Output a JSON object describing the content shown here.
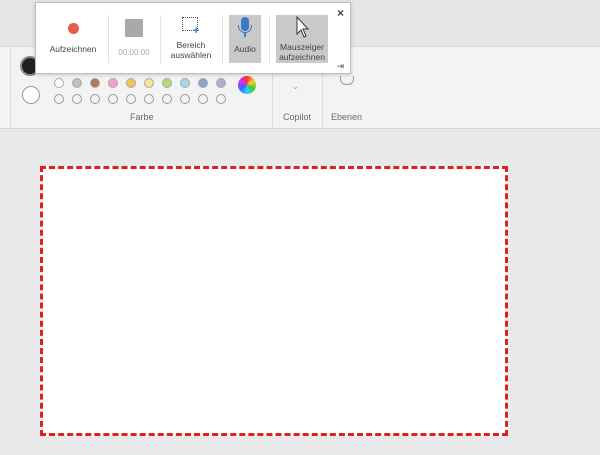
{
  "ribbon": {
    "groups": {
      "farbe": "Farbe",
      "copilot": "Copilot",
      "ebenen": "Ebenen"
    },
    "colors": {
      "row1": [
        "#ffffff",
        "#c0c0c0",
        "#b07a55",
        "#f2a1c7",
        "#f4c44c",
        "#f2e78a",
        "#b6da6e",
        "#a9d7f2",
        "#8fa4c9",
        "#b9a8d6"
      ],
      "row2": [
        "none",
        "none",
        "none",
        "none",
        "none",
        "none",
        "none",
        "none",
        "none",
        "none"
      ]
    }
  },
  "recorder": {
    "record_label": "Aufzeichnen",
    "timer": "00:00:00",
    "select_area_label": "Bereich auswählen",
    "audio_label": "Audio",
    "mouse_pointer_label": "Mauszeiger aufzeichnen",
    "close_symbol": "×",
    "pin_symbol": "⇥",
    "accent_record": "#e35d47",
    "accent_audio": "#3c78c7"
  },
  "canvas": {
    "selection_border_color": "#e02020"
  }
}
